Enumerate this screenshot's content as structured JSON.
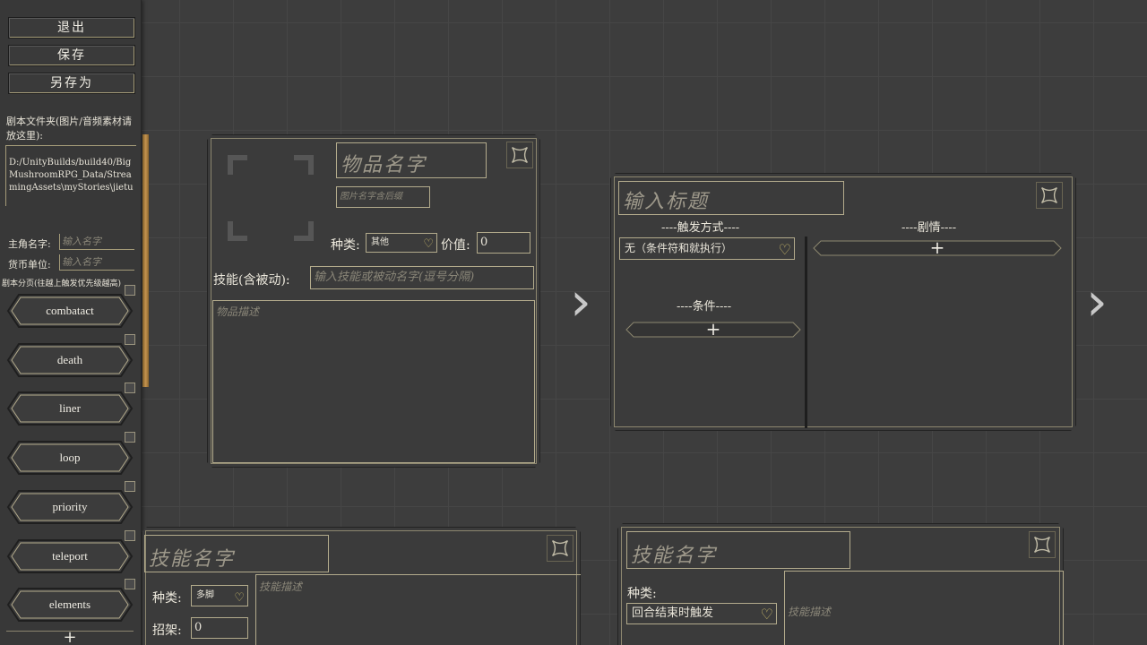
{
  "sidebar": {
    "buttons": {
      "exit": "退出",
      "save": "保存",
      "save_as": "另存为"
    },
    "folder_label": "剧本文件夹(图片/音频素材请放这里):",
    "folder_path": "D:/UnityBuilds/build40/BigMushroomRPG_Data/StreamingAssets\\myStories\\jietu",
    "protagonist_label": "主角名字:",
    "protagonist_placeholder": "输入名字",
    "currency_label": "货币单位:",
    "currency_placeholder": "输入名字",
    "chapters_label": "剧本分页(往越上触发优先级越高)",
    "chapters": [
      "combatact",
      "death",
      "liner",
      "loop",
      "priority",
      "teleport",
      "elements"
    ],
    "add_label": "+"
  },
  "item_node": {
    "name_placeholder": "物品名字",
    "image_placeholder": "图片名字含后缀",
    "type_label": "种类:",
    "type_value": "其他",
    "price_label": "价值:",
    "price_value": "0",
    "skill_label": "技能(含被动):",
    "skill_placeholder": "输入技能或被动名字(逗号分隔)",
    "desc_placeholder": "物品描述"
  },
  "event_node": {
    "title_placeholder": "输入标题",
    "trigger_header": "----触发方式----",
    "plot_header": "----剧情----",
    "trigger_value": "无（条件符和就执行）",
    "condition_header": "----条件----",
    "add_label": "+"
  },
  "skill_node_left": {
    "name_placeholder": "技能名字",
    "type_label": "种类:",
    "type_value": "多脚",
    "desc_placeholder": "技能描述",
    "parry_label": "招架:",
    "parry_value": "0"
  },
  "skill_node_right": {
    "name_placeholder": "技能名字",
    "type_label": "种类:",
    "type_value": "回合结束时触发",
    "desc_placeholder": "技能描述"
  },
  "connectors": {
    "arrow": "›"
  },
  "colors": {
    "accent": "#b3ab8c",
    "background": "#3d3d3d",
    "heart": "#c8b86a"
  }
}
